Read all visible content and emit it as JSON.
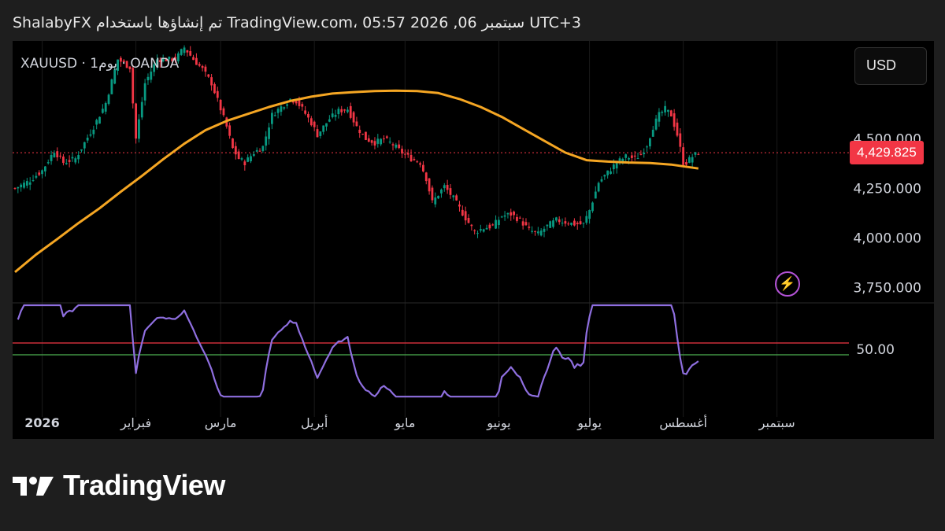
{
  "header": {
    "text": "ShalabyFX تم إنشاؤها باستخدام TradingView.com، 05:57 2026 ,06 سبتمبر UTC+3"
  },
  "symbol_label": "XAUUSD · يوم1 · OANDA",
  "currency_button": "USD",
  "brand": {
    "name": "TradingView",
    "logo_icon": "tradingview-logo-icon"
  },
  "icons": {
    "flash": "flash-icon"
  },
  "colors": {
    "background": "#000000",
    "up_candle": "#089981",
    "down_candle": "#f23645",
    "moving_average": "#f5a623",
    "rsi_line": "#8f6fe0",
    "rsi_upper_line": "#f23645",
    "rsi_lower_line": "#4caf50",
    "price_tag": "#f23645"
  },
  "chart_data": [
    {
      "type": "candlestick",
      "symbol": "XAUUSD",
      "interval": "1D",
      "last_price": "4,429.825",
      "y_ticks": [
        "4,500.000",
        "4,250.000",
        "4,000.000",
        "3,750.000"
      ],
      "y_tick_values": [
        4500,
        4250,
        4000,
        3750
      ],
      "ylim": [
        3677,
        4993
      ],
      "x_labels": [
        "2026",
        "فبراير",
        "مارس",
        "أبريل",
        "مايو",
        "يونيو",
        "يوليو",
        "أغسطس",
        "سبتمبر"
      ],
      "x_label_days": [
        9,
        40,
        68,
        99,
        129,
        160,
        190,
        221,
        252
      ],
      "close_path": [
        [
          0,
          4250
        ],
        [
          5,
          4290
        ],
        [
          9,
          4340
        ],
        [
          13,
          4440
        ],
        [
          16,
          4380
        ],
        [
          20,
          4400
        ],
        [
          26,
          4560
        ],
        [
          30,
          4680
        ],
        [
          34,
          4900
        ],
        [
          38,
          4860
        ],
        [
          40,
          4500
        ],
        [
          43,
          4780
        ],
        [
          47,
          4900
        ],
        [
          53,
          4900
        ],
        [
          56,
          4960
        ],
        [
          59,
          4900
        ],
        [
          62,
          4850
        ],
        [
          65,
          4780
        ],
        [
          68,
          4650
        ],
        [
          70,
          4560
        ],
        [
          72,
          4450
        ],
        [
          74,
          4400
        ],
        [
          76,
          4380
        ],
        [
          79,
          4430
        ],
        [
          82,
          4460
        ],
        [
          85,
          4620
        ],
        [
          88,
          4660
        ],
        [
          91,
          4700
        ],
        [
          93,
          4690
        ],
        [
          95,
          4650
        ],
        [
          98,
          4580
        ],
        [
          100,
          4520
        ],
        [
          104,
          4600
        ],
        [
          107,
          4640
        ],
        [
          110,
          4650
        ],
        [
          113,
          4560
        ],
        [
          116,
          4500
        ],
        [
          119,
          4480
        ],
        [
          122,
          4500
        ],
        [
          125,
          4470
        ],
        [
          128,
          4430
        ],
        [
          131,
          4400
        ],
        [
          134,
          4380
        ],
        [
          136,
          4300
        ],
        [
          138,
          4180
        ],
        [
          142,
          4260
        ],
        [
          145,
          4200
        ],
        [
          149,
          4100
        ],
        [
          152,
          4030
        ],
        [
          155,
          4050
        ],
        [
          158,
          4060
        ],
        [
          161,
          4110
        ],
        [
          164,
          4120
        ],
        [
          167,
          4090
        ],
        [
          170,
          4040
        ],
        [
          173,
          4020
        ],
        [
          176,
          4060
        ],
        [
          179,
          4090
        ],
        [
          182,
          4080
        ],
        [
          185,
          4070
        ],
        [
          188,
          4070
        ],
        [
          190,
          4140
        ],
        [
          193,
          4280
        ],
        [
          196,
          4330
        ],
        [
          199,
          4380
        ],
        [
          202,
          4410
        ],
        [
          205,
          4400
        ],
        [
          207,
          4420
        ],
        [
          209,
          4470
        ],
        [
          211,
          4560
        ],
        [
          213,
          4620
        ],
        [
          215,
          4650
        ],
        [
          217,
          4620
        ],
        [
          219,
          4520
        ],
        [
          221,
          4380
        ],
        [
          222,
          4380
        ],
        [
          224,
          4410
        ],
        [
          226,
          4430
        ]
      ],
      "moving_average": [
        [
          0,
          3828
        ],
        [
          7,
          3917
        ],
        [
          14,
          3995
        ],
        [
          21,
          4075
        ],
        [
          28,
          4150
        ],
        [
          35,
          4233
        ],
        [
          42,
          4313
        ],
        [
          49,
          4397
        ],
        [
          56,
          4475
        ],
        [
          63,
          4543
        ],
        [
          70,
          4590
        ],
        [
          77,
          4625
        ],
        [
          84,
          4660
        ],
        [
          91,
          4690
        ],
        [
          98,
          4712
        ],
        [
          105,
          4728
        ],
        [
          112,
          4735
        ],
        [
          119,
          4740
        ],
        [
          126,
          4742
        ],
        [
          133,
          4740
        ],
        [
          140,
          4730
        ],
        [
          147,
          4700
        ],
        [
          154,
          4660
        ],
        [
          161,
          4610
        ],
        [
          168,
          4550
        ],
        [
          175,
          4490
        ],
        [
          182,
          4430
        ],
        [
          189,
          4392
        ],
        [
          196,
          4385
        ],
        [
          203,
          4380
        ],
        [
          210,
          4378
        ],
        [
          217,
          4370
        ],
        [
          226,
          4350
        ]
      ]
    },
    {
      "type": "line",
      "indicator": "RSI",
      "y_tick": "50.00",
      "reference_lines": [
        50,
        70
      ]
    }
  ]
}
